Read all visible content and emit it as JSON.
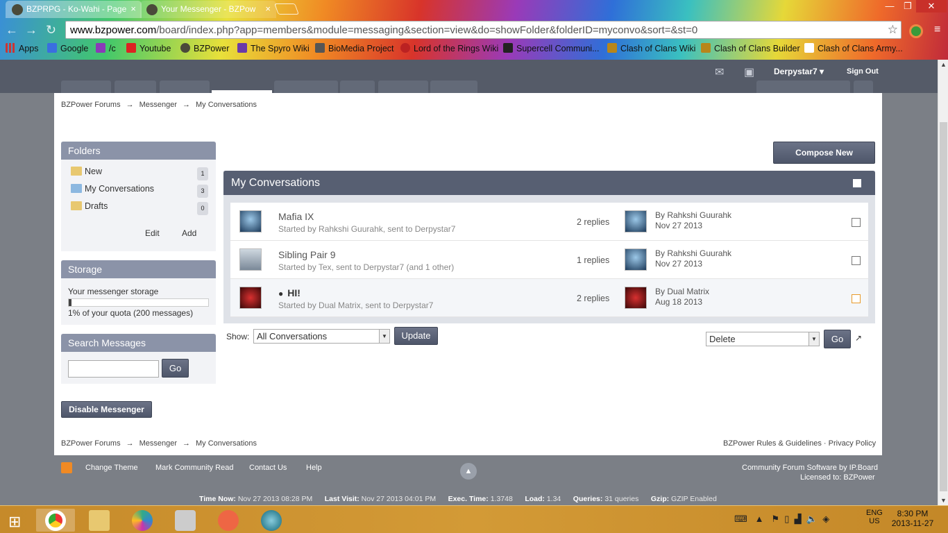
{
  "browser": {
    "tabs": [
      {
        "title": "BZPRPG - Ko-Wahi - Page",
        "close": "×"
      },
      {
        "title": "Your Messenger - BZPow",
        "close": "×"
      }
    ],
    "url_domain": "www.bzpower.com",
    "url_path": "/board/index.php?app=members&module=messaging&section=view&do=showFolder&folderID=myconvo&sort=&st=0",
    "bookmarks": [
      "Apps",
      "Google",
      "/c",
      "Youtube",
      "BZPower",
      "The Spyro Wiki",
      "BioMedia Project",
      "Lord of the Rings Wiki",
      "Supercell Communi...",
      "Clash of Clans Wiki",
      "Clash of Clans Builder",
      "Clash of Clans Army..."
    ]
  },
  "header": {
    "username": "Derpystar7",
    "signout": "Sign Out"
  },
  "breadcrumb": {
    "items": [
      "BZPower Forums",
      "Messenger",
      "My Conversations"
    ],
    "sep": "→"
  },
  "sidebar": {
    "folders_title": "Folders",
    "folders": [
      {
        "name": "New",
        "count": "1"
      },
      {
        "name": "My Conversations",
        "count": "3"
      },
      {
        "name": "Drafts",
        "count": "0"
      }
    ],
    "edit": "Edit",
    "add": "Add",
    "storage_title": "Storage",
    "storage_label": "Your messenger storage",
    "storage_fraction": 0.01,
    "storage_text": "1% of your quota (200 messages)",
    "search_title": "Search Messages",
    "search_go": "Go",
    "disable": "Disable Messenger"
  },
  "main": {
    "compose": "Compose New",
    "title": "My Conversations",
    "conversations": [
      {
        "title": "Mafia IX",
        "started": "Started by Rahkshi Guurahk, sent to Derpystar7",
        "replies": "2 replies",
        "by": "By Rahkshi Guurahk",
        "date": "Nov 27 2013",
        "unread": false
      },
      {
        "title": "Sibling Pair 9",
        "started": "Started by Tex, sent to Derpystar7 (and 1 other)",
        "replies": "1 replies",
        "by": "By Rahkshi Guurahk",
        "date": "Nov 27 2013",
        "unread": false
      },
      {
        "title": "HI!",
        "started": "Started by Dual Matrix, sent to Derpystar7",
        "replies": "2 replies",
        "by": "By Dual Matrix",
        "date": "Aug 18 2013",
        "unread": true
      }
    ],
    "show_label": "Show:",
    "show_value": "All Conversations",
    "update": "Update",
    "action_value": "Delete",
    "action_go": "Go"
  },
  "footer": {
    "rules": "BZPower Rules & Guidelines",
    "dot": "·",
    "privacy": "Privacy Policy",
    "links": [
      "Change Theme",
      "Mark Community Read",
      "Contact Us",
      "Help"
    ],
    "software": "Community Forum Software by IP.Board",
    "licensed": "Licensed to: BZPower",
    "stats": [
      {
        "label": "Time Now:",
        "value": "Nov 27 2013 08:28 PM"
      },
      {
        "label": "Last Visit:",
        "value": "Nov 27 2013 04:01 PM"
      },
      {
        "label": "Exec. Time:",
        "value": "1.3748"
      },
      {
        "label": "Load:",
        "value": "1.34"
      },
      {
        "label": "Queries:",
        "value": "31 queries"
      },
      {
        "label": "Gzip:",
        "value": "GZIP Enabled"
      }
    ]
  },
  "taskbar": {
    "lang1": "ENG",
    "lang2": "US",
    "time": "8:30 PM",
    "date": "2013-11-27"
  }
}
